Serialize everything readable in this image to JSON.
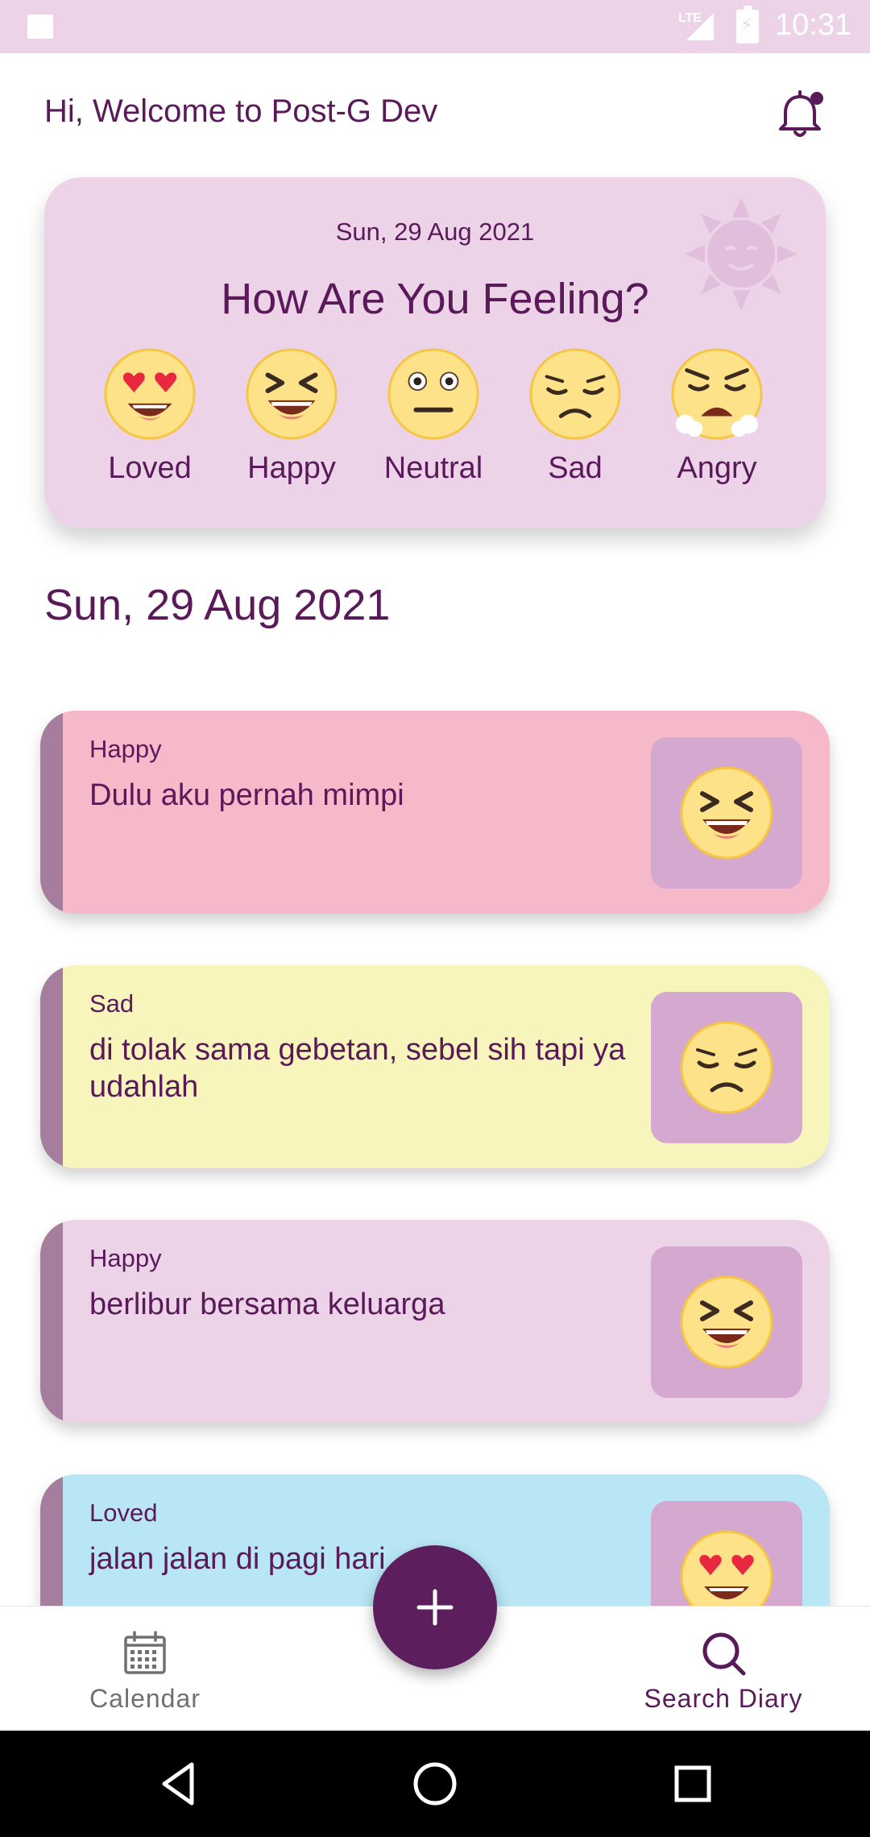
{
  "status_bar": {
    "time": "10:31",
    "network": "LTE"
  },
  "header": {
    "greeting": "Hi, Welcome to Post-G Dev"
  },
  "mood_card": {
    "date": "Sun, 29 Aug 2021",
    "question": "How Are You Feeling?",
    "moods": [
      {
        "label": "Loved",
        "icon": "loved-face-icon"
      },
      {
        "label": "Happy",
        "icon": "happy-face-icon"
      },
      {
        "label": "Neutral",
        "icon": "neutral-face-icon"
      },
      {
        "label": "Sad",
        "icon": "sad-face-icon"
      },
      {
        "label": "Angry",
        "icon": "angry-face-icon"
      }
    ]
  },
  "section_date": "Sun, 29 Aug 2021",
  "diary_entries": [
    {
      "mood": "Happy",
      "text": "Dulu aku pernah mimpi",
      "color": "#f6b9c9",
      "icon": "happy-face-icon"
    },
    {
      "mood": "Sad",
      "text": "di tolak sama gebetan, sebel sih tapi ya udahlah",
      "color": "#f7f4bc",
      "icon": "sad-face-icon"
    },
    {
      "mood": "Happy",
      "text": "berlibur bersama keluarga",
      "color": "#ecd3e8",
      "icon": "happy-face-icon"
    },
    {
      "mood": "Loved",
      "text": "jalan jalan di pagi hari",
      "color": "#b9e6f5",
      "icon": "loved-face-icon"
    }
  ],
  "bottom_nav": {
    "calendar_label": "Calendar",
    "search_label": "Search Diary"
  },
  "colors": {
    "primary": "#5c1e5c",
    "card_bg": "#ecd3e8",
    "thumb_bg": "#d5a8cf",
    "stripe": "#a47e9c"
  }
}
